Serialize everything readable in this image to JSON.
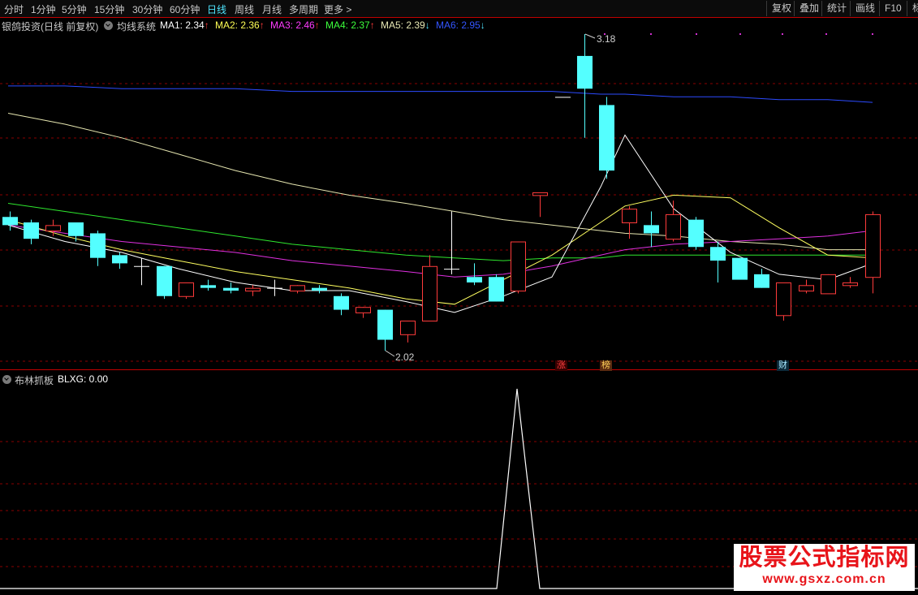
{
  "toolbar": {
    "periods": [
      "分时",
      "1分钟",
      "5分钟",
      "15分钟",
      "30分钟",
      "60分钟",
      "日线",
      "周线",
      "月线",
      "多周期",
      "更多 >"
    ],
    "active_period": "日线",
    "buttons": [
      "复权",
      "叠加",
      "统计",
      "画线",
      "F10",
      "标"
    ]
  },
  "info": {
    "stock": "银鸽投资(日线 前复权)",
    "indicator": "均线系统",
    "ma": [
      {
        "label": "MA1:",
        "value": "2.34",
        "arrow": "↑",
        "color": "#ffffff",
        "arrow_color": "#ff3b3b"
      },
      {
        "label": "MA2:",
        "value": "2.36",
        "arrow": "↑",
        "color": "#ffff55",
        "arrow_color": "#ff3b3b"
      },
      {
        "label": "MA3:",
        "value": "2.46",
        "arrow": "↑",
        "color": "#ff3bff",
        "arrow_color": "#ff3b3b"
      },
      {
        "label": "MA4:",
        "value": "2.37",
        "arrow": "↑",
        "color": "#3cff3c",
        "arrow_color": "#ff3b3b"
      },
      {
        "label": "MA5:",
        "value": "2.39",
        "arrow": "↓",
        "color": "#e8e8b4",
        "arrow_color": "#4fe6ff"
      },
      {
        "label": "MA6:",
        "value": "2.95",
        "arrow": "↓",
        "color": "#3355ff",
        "arrow_color": "#4fe6ff"
      }
    ]
  },
  "callouts": {
    "high": "3.18",
    "low": "2.02"
  },
  "badges": [
    {
      "text": "涨",
      "color": "#ff4040",
      "bg": "#3a0000"
    },
    {
      "text": "榜",
      "color": "#ffd25a",
      "bg": "#5a2a10"
    },
    {
      "text": "财",
      "color": "#a8e8ff",
      "bg": "#0c2a3a"
    }
  ],
  "indicator": {
    "name": "布林抓板",
    "readout": "BLXG: 0.00"
  },
  "watermark": {
    "line1": "股票公式指标网",
    "line2": "www.gsxz.com.cn"
  },
  "colors": {
    "up": "#ff3b3b",
    "down": "#54ffff",
    "grid": "#7a0000",
    "border": "#c00000"
  },
  "chart_data": [
    {
      "type": "candlestick",
      "candles": [
        {
          "o": 2.51,
          "h": 2.53,
          "l": 2.46,
          "c": 2.48
        },
        {
          "o": 2.49,
          "h": 2.5,
          "l": 2.41,
          "c": 2.43
        },
        {
          "o": 2.46,
          "h": 2.5,
          "l": 2.44,
          "c": 2.48
        },
        {
          "o": 2.49,
          "h": 2.49,
          "l": 2.42,
          "c": 2.44
        },
        {
          "o": 2.45,
          "h": 2.46,
          "l": 2.33,
          "c": 2.36
        },
        {
          "o": 2.37,
          "h": 2.38,
          "l": 2.32,
          "c": 2.34
        },
        {
          "o": 2.33,
          "h": 2.36,
          "l": 2.26,
          "c": 2.33
        },
        {
          "o": 2.33,
          "h": 2.33,
          "l": 2.21,
          "c": 2.22
        },
        {
          "o": 2.22,
          "h": 2.27,
          "l": 2.21,
          "c": 2.27
        },
        {
          "o": 2.26,
          "h": 2.28,
          "l": 2.24,
          "c": 2.25
        },
        {
          "o": 2.25,
          "h": 2.27,
          "l": 2.23,
          "c": 2.24
        },
        {
          "o": 2.24,
          "h": 2.26,
          "l": 2.22,
          "c": 2.25
        },
        {
          "o": 2.25,
          "h": 2.28,
          "l": 2.22,
          "c": 2.25
        },
        {
          "o": 2.24,
          "h": 2.26,
          "l": 2.23,
          "c": 2.26
        },
        {
          "o": 2.25,
          "h": 2.26,
          "l": 2.23,
          "c": 2.24
        },
        {
          "o": 2.22,
          "h": 2.23,
          "l": 2.15,
          "c": 2.17
        },
        {
          "o": 2.16,
          "h": 2.18,
          "l": 2.14,
          "c": 2.18
        },
        {
          "o": 2.17,
          "h": 2.17,
          "l": 2.02,
          "c": 2.06
        },
        {
          "o": 2.08,
          "h": 2.13,
          "l": 2.05,
          "c": 2.13
        },
        {
          "o": 2.13,
          "h": 2.37,
          "l": 2.13,
          "c": 2.33
        },
        {
          "o": 2.32,
          "h": 2.53,
          "l": 2.3,
          "c": 2.32
        },
        {
          "o": 2.29,
          "h": 2.34,
          "l": 2.26,
          "c": 2.27
        },
        {
          "o": 2.29,
          "h": 2.3,
          "l": 2.2,
          "c": 2.2
        },
        {
          "o": 2.24,
          "h": 2.42,
          "l": 2.23,
          "c": 2.42
        },
        {
          "o": 2.59,
          "h": 2.6,
          "l": 2.51,
          "c": 2.6
        },
        {
          "o": 2.95,
          "h": 2.95,
          "l": 2.95,
          "c": 2.95
        },
        {
          "o": 3.1,
          "h": 3.18,
          "l": 2.8,
          "c": 2.98
        },
        {
          "o": 2.92,
          "h": 2.95,
          "l": 2.65,
          "c": 2.68
        },
        {
          "o": 2.49,
          "h": 2.55,
          "l": 2.43,
          "c": 2.54
        },
        {
          "o": 2.48,
          "h": 2.53,
          "l": 2.4,
          "c": 2.45
        },
        {
          "o": 2.43,
          "h": 2.57,
          "l": 2.42,
          "c": 2.52
        },
        {
          "o": 2.5,
          "h": 2.51,
          "l": 2.39,
          "c": 2.4
        },
        {
          "o": 2.4,
          "h": 2.42,
          "l": 2.27,
          "c": 2.35
        },
        {
          "o": 2.36,
          "h": 2.36,
          "l": 2.29,
          "c": 2.28
        },
        {
          "o": 2.3,
          "h": 2.32,
          "l": 2.25,
          "c": 2.25
        },
        {
          "o": 2.15,
          "h": 2.27,
          "l": 2.13,
          "c": 2.27
        },
        {
          "o": 2.24,
          "h": 2.28,
          "l": 2.23,
          "c": 2.26
        },
        {
          "o": 2.23,
          "h": 2.3,
          "l": 2.23,
          "c": 2.3
        },
        {
          "o": 2.26,
          "h": 2.29,
          "l": 2.25,
          "c": 2.27
        },
        {
          "o": 2.29,
          "h": 2.53,
          "l": 2.23,
          "c": 2.52
        }
      ],
      "series": [
        {
          "name": "MA6",
          "values": [
            2.99,
            2.99,
            2.98,
            2.98,
            2.98,
            2.97,
            2.97,
            2.97,
            2.97,
            2.97,
            2.97,
            2.96,
            2.96,
            2.95,
            2.95,
            2.94,
            2.94,
            2.93
          ]
        },
        {
          "name": "MA5",
          "values": [
            2.89,
            2.85,
            2.8,
            2.74,
            2.68,
            2.63,
            2.59,
            2.56,
            2.53,
            2.5,
            2.48,
            2.46,
            2.45,
            2.44,
            2.42,
            2.41,
            2.39,
            2.39
          ]
        },
        {
          "name": "MA4",
          "values": [
            2.56,
            2.53,
            2.5,
            2.47,
            2.44,
            2.41,
            2.39,
            2.37,
            2.36,
            2.35,
            2.36,
            2.36,
            2.37,
            2.37,
            2.37,
            2.37,
            2.37,
            2.37
          ]
        },
        {
          "name": "MA3",
          "values": [
            2.48,
            2.45,
            2.42,
            2.4,
            2.38,
            2.35,
            2.33,
            2.31,
            2.29,
            2.3,
            2.33,
            2.37,
            2.39,
            2.41,
            2.42,
            2.43,
            2.44,
            2.46
          ]
        },
        {
          "name": "MA2",
          "values": [
            2.5,
            2.44,
            2.39,
            2.35,
            2.31,
            2.28,
            2.25,
            2.21,
            2.19,
            2.28,
            2.37,
            2.49,
            2.55,
            2.59,
            2.58,
            2.47,
            2.37,
            2.36
          ]
        },
        {
          "name": "MA1",
          "values": [
            2.48,
            2.42,
            2.38,
            2.32,
            2.27,
            2.24,
            2.24,
            2.2,
            2.16,
            2.22,
            2.29,
            2.62,
            2.81,
            2.54,
            2.38,
            2.3,
            2.28,
            2.34
          ]
        }
      ]
    },
    {
      "type": "line",
      "name": "BLXG",
      "values": [
        0,
        0,
        0,
        0,
        0,
        0,
        0,
        0,
        0,
        0,
        0,
        0,
        0,
        0,
        0,
        0,
        0,
        0,
        0,
        0,
        0,
        0,
        0,
        0,
        0,
        1,
        0,
        0,
        0,
        0,
        0,
        0,
        0,
        0,
        0,
        0,
        0,
        0,
        0,
        0,
        0,
        0,
        0,
        0,
        0
      ],
      "ylim": [
        0,
        1
      ]
    }
  ]
}
